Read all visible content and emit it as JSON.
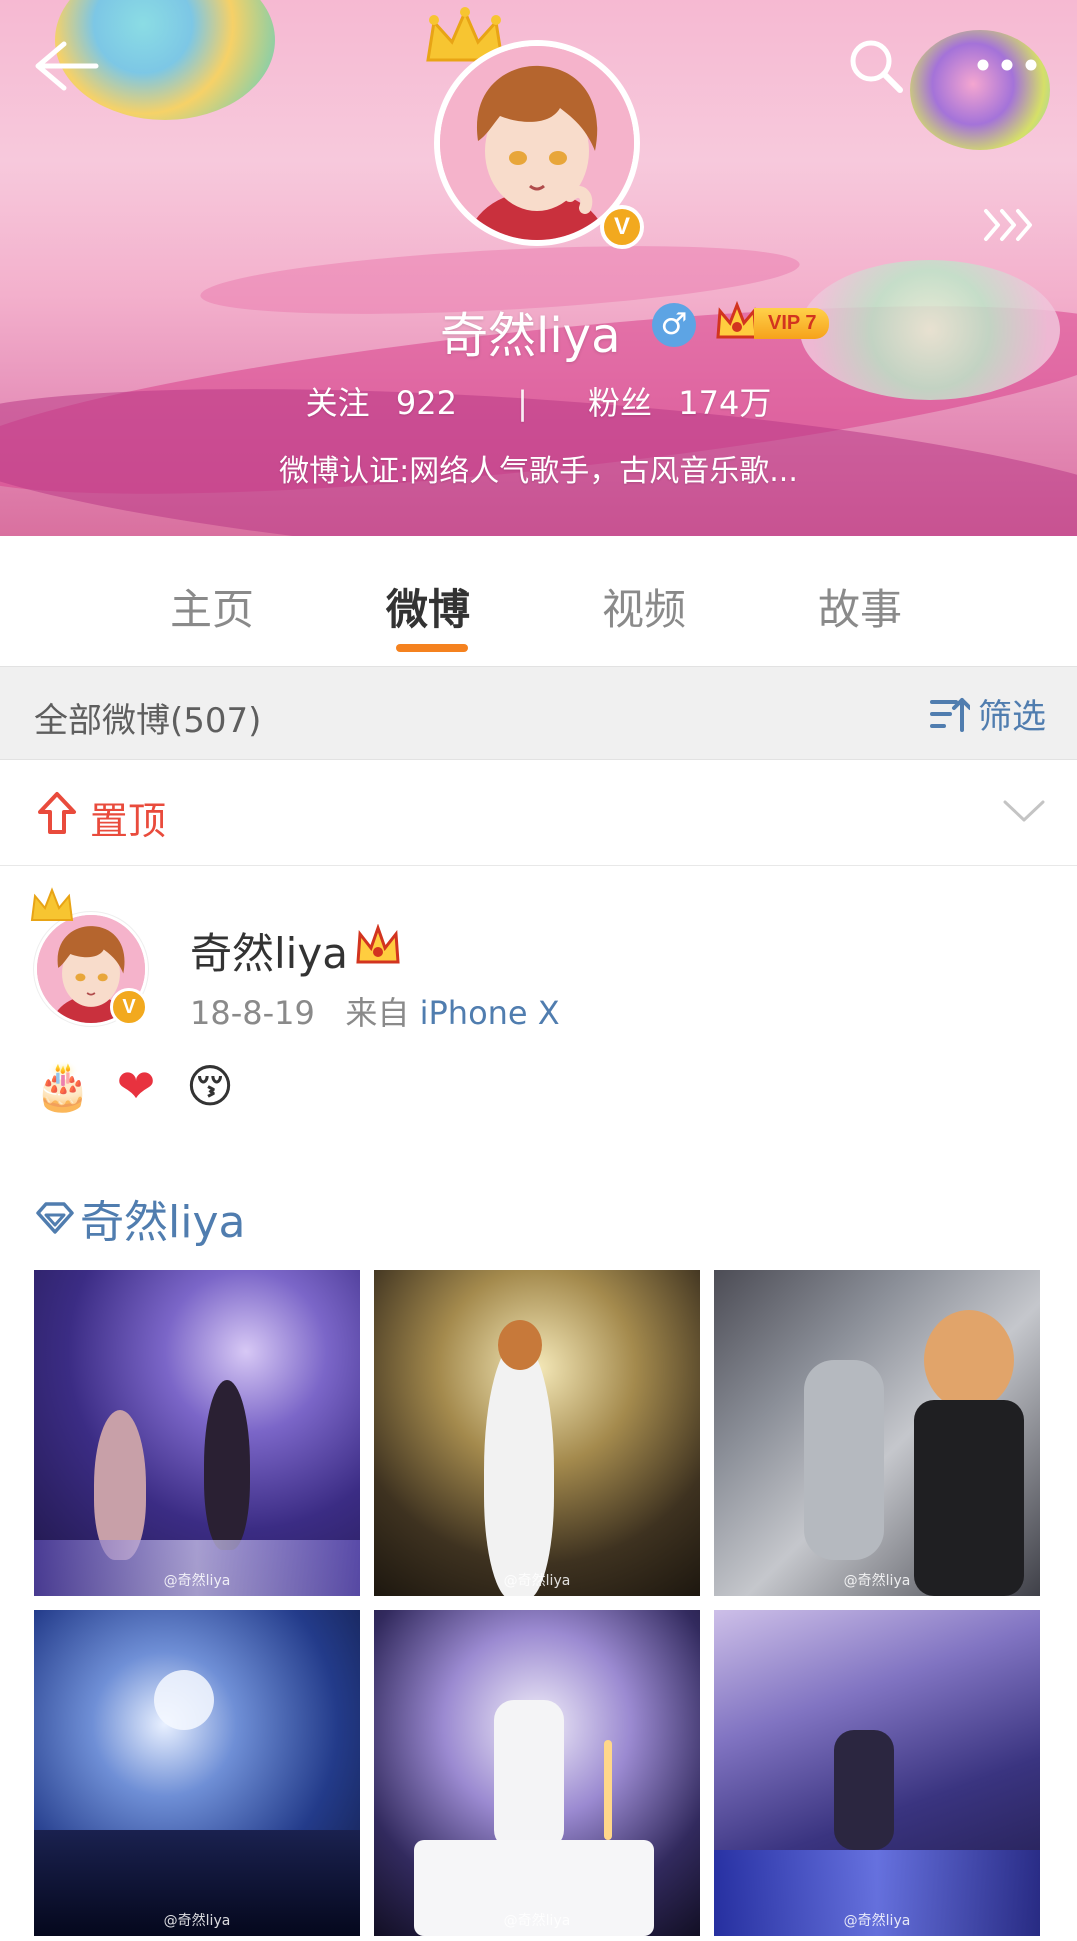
{
  "header": {
    "profile_name": "奇然liya",
    "gender_symbol": "♂",
    "vip_label": "VIP 7",
    "verified_badge": "V",
    "following_label": "关注",
    "following_count": "922",
    "stats_divider": "|",
    "fans_label": "粉丝",
    "fans_count": "174万",
    "verification": "微博认证:网络人气歌手，古风音乐歌...",
    "icons": [
      "back-arrow-icon",
      "search-icon",
      "more-icon",
      "forward-arrows-icon"
    ]
  },
  "tabs": [
    {
      "label": "主页",
      "active": false
    },
    {
      "label": "微博",
      "active": true
    },
    {
      "label": "视频",
      "active": false
    },
    {
      "label": "故事",
      "active": false
    }
  ],
  "filter_bar": {
    "all_posts": "全部微博(507)",
    "filter_label": "筛选"
  },
  "pinned": {
    "label": "置顶"
  },
  "post": {
    "author": "奇然liya",
    "verified_badge": "V",
    "date": "18-8-19",
    "source_prefix": "来自",
    "source": "iPhone X",
    "emojis": [
      "🎂",
      "❤",
      "😚"
    ],
    "tag": "奇然liya",
    "photo_watermark": "@奇然liya",
    "photos": [
      "concert-stage-photo",
      "singer-mic-photo",
      "makeup-backstage-photo",
      "crowd-lights-photo",
      "birthday-cake-photo",
      "stage-lightsticks-photo"
    ]
  },
  "colors": {
    "accent_orange": "#f5821f",
    "link_blue": "#507daf",
    "pin_red": "#e94b3c",
    "verified_gold": "#f2a91e"
  }
}
